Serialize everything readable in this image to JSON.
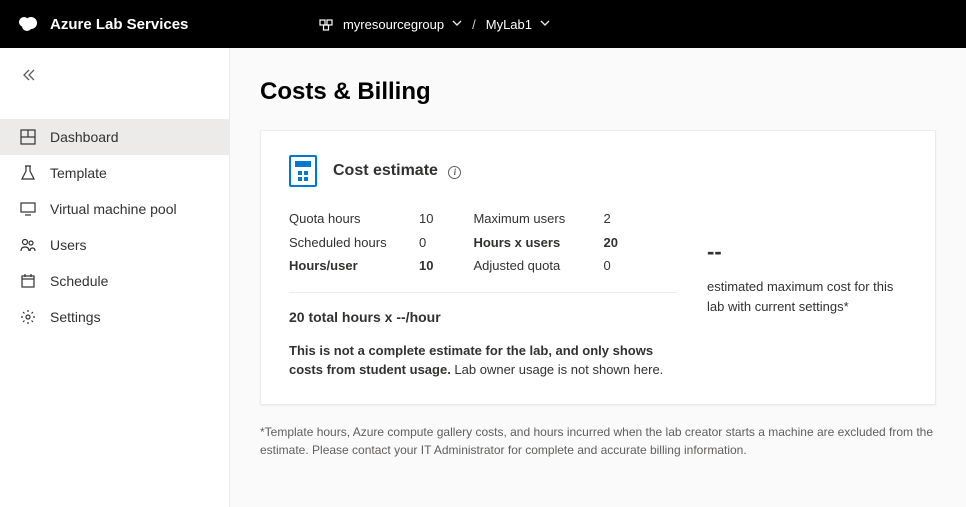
{
  "header": {
    "app_name": "Azure Lab Services",
    "breadcrumb": {
      "resource_group": "myresourcegroup",
      "lab": "MyLab1",
      "separator": "/"
    }
  },
  "sidebar": {
    "items": [
      {
        "label": "Dashboard"
      },
      {
        "label": "Template"
      },
      {
        "label": "Virtual machine pool"
      },
      {
        "label": "Users"
      },
      {
        "label": "Schedule"
      },
      {
        "label": "Settings"
      }
    ]
  },
  "page": {
    "title": "Costs & Billing",
    "card_title": "Cost estimate",
    "stats": {
      "quota_hours_label": "Quota hours",
      "quota_hours_value": "10",
      "scheduled_hours_label": "Scheduled hours",
      "scheduled_hours_value": "0",
      "hours_per_user_label": "Hours/user",
      "hours_per_user_value": "10",
      "max_users_label": "Maximum users",
      "max_users_value": "2",
      "hours_x_users_label": "Hours x users",
      "hours_x_users_value": "20",
      "adjusted_quota_label": "Adjusted quota",
      "adjusted_quota_value": "0"
    },
    "summary_line": "20 total hours x --/hour",
    "disclaimer_bold": "This is not a complete estimate for the lab, and only shows costs from student usage.",
    "disclaimer_rest": " Lab owner usage is not shown here.",
    "estimate_value": "--",
    "estimate_text": "estimated maximum cost for this lab with current settings*",
    "footnote": "*Template hours, Azure compute gallery costs, and hours incurred when the lab creator starts a machine are excluded from the estimate. Please contact your IT Administrator for complete and accurate billing information."
  }
}
